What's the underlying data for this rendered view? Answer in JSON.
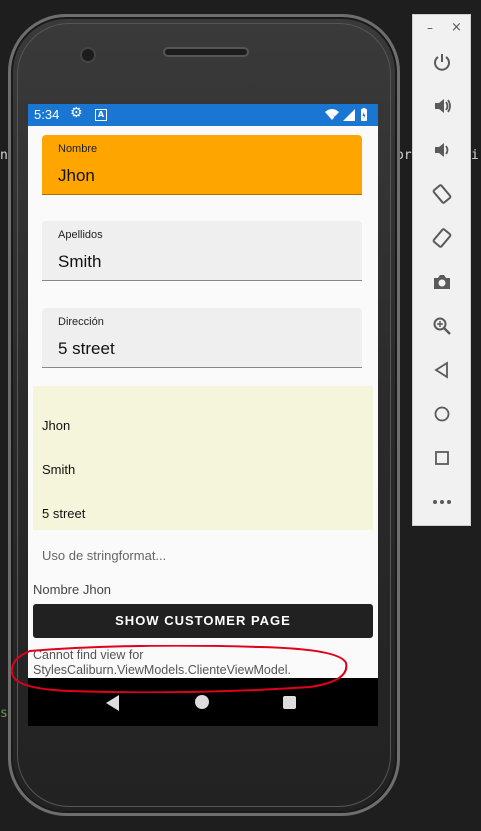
{
  "status_bar": {
    "time": "5:34"
  },
  "form": {
    "nombre": {
      "label": "Nombre",
      "value": "Jhon"
    },
    "apellidos": {
      "label": "Apellidos",
      "value": "Smith"
    },
    "direccion": {
      "label": "Dirección",
      "value": "5 street"
    }
  },
  "summary": {
    "lines": [
      "Jhon",
      "Smith",
      "5 street"
    ]
  },
  "stringformat_placeholder": "Uso de stringformat...",
  "nombre_label": "Nombre Jhon",
  "show_customer_button": "SHOW CUSTOMER PAGE",
  "error_message": "Cannot find view for StylesCaliburn.ViewModels.ClienteViewModel.",
  "emulator_toolbar": {
    "minimize": "–",
    "close": "×",
    "buttons": [
      "power-icon",
      "volume-up-icon",
      "volume-down-icon",
      "rotate-left-icon",
      "rotate-right-icon",
      "camera-icon",
      "zoom-icon",
      "back-icon",
      "home-icon",
      "overview-icon",
      "more-icon"
    ]
  },
  "background_code": {
    "left_fragment": "n",
    "right_fragment": "or",
    "right_fragment2": "i",
    "bottom_fragment": "s"
  },
  "colors": {
    "status_bar": "#1976d2",
    "highlight_field": "#ffa500",
    "panel": "#f5f5dc",
    "button": "#212121",
    "annotation": "#e0001a"
  }
}
